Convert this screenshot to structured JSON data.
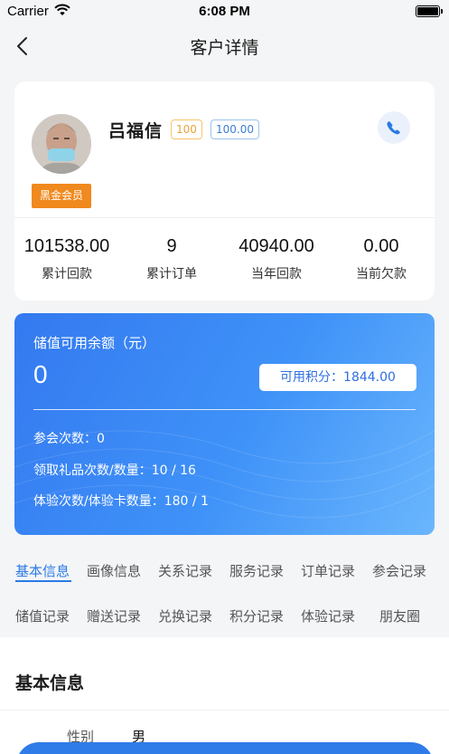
{
  "status_bar": {
    "carrier": "Carrier",
    "time": "6:08 PM"
  },
  "nav": {
    "title": "客户详情"
  },
  "customer": {
    "name": "吕福信",
    "level_badge": "100",
    "score_badge": "100.00",
    "member_tag": "黑金会员"
  },
  "stats": [
    {
      "value": "101538.00",
      "label": "累计回款"
    },
    {
      "value": "9",
      "label": "累计订单"
    },
    {
      "value": "40940.00",
      "label": "当年回款"
    },
    {
      "value": "0.00",
      "label": "当前欠款"
    }
  ],
  "balance_card": {
    "title": "储值可用余额（元）",
    "amount": "0",
    "points": "可用积分：1844.00",
    "meeting_count": "参会次数：0",
    "gift_count": "领取礼品次数/数量：10 / 16",
    "experience_count": "体验次数/体验卡数量：180 / 1"
  },
  "tabs_row1": [
    "基本信息",
    "画像信息",
    "关系记录",
    "服务记录",
    "订单记录",
    "参会记录"
  ],
  "tabs_row2": [
    "储值记录",
    "赠送记录",
    "兑换记录",
    "积分记录",
    "体验记录",
    "朋友圈"
  ],
  "section": {
    "title": "基本信息",
    "field_label": "性别",
    "field_value": "男"
  },
  "colors": {
    "accent": "#2b7ae6",
    "member_tag": "#f0891e",
    "card_gradient_start": "#3479f0",
    "card_gradient_end": "#6ab6fd"
  },
  "icons": {
    "back": "chevron-left-icon",
    "phone": "phone-icon",
    "wifi": "wifi-icon",
    "battery": "battery-icon"
  }
}
